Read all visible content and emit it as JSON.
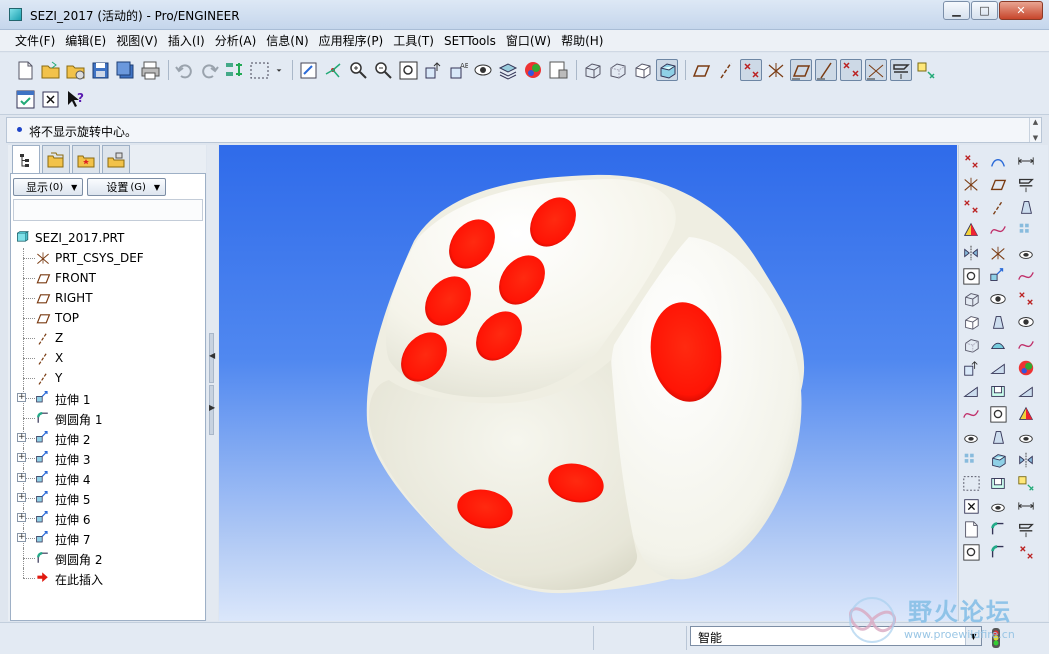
{
  "window": {
    "title": "SEZI_2017 (活动的) - Pro/ENGINEER",
    "minimize": "▁",
    "maximize": "□",
    "close": "✕"
  },
  "menu": [
    {
      "label": "文件(F)"
    },
    {
      "label": "编辑(E)"
    },
    {
      "label": "视图(V)"
    },
    {
      "label": "插入(I)"
    },
    {
      "label": "分析(A)"
    },
    {
      "label": "信息(N)"
    },
    {
      "label": "应用程序(P)"
    },
    {
      "label": "工具(T)"
    },
    {
      "label": "SETTools"
    },
    {
      "label": "窗口(W)"
    },
    {
      "label": "帮助(H)"
    }
  ],
  "toolbar": {
    "row1": [
      "new-icon",
      "open-icon",
      "open-folder-icon",
      "save-icon",
      "save-copy-icon",
      "print-icon",
      "|",
      "undo-icon",
      "redo-icon",
      "regenerate-icon",
      "select-box-icon",
      "dropdown-icon",
      "|",
      "repaint-icon",
      "spin-center-icon",
      "zoom-in-icon",
      "zoom-out-icon",
      "refit-icon",
      "orient-icon",
      "saved-views-icon",
      "appearance-icon",
      "layers-icon",
      "color-icon",
      "model-tree-icon",
      "|",
      "wireframe-icon",
      "hidden-line-icon",
      "no-hidden-icon",
      "shading-icon",
      "|",
      "datum-plane-icon",
      "datum-axis-icon",
      "datum-point-icon",
      "csys-icon",
      "plane-tag-icon",
      "axis-tag-icon",
      "point-tag-icon",
      "csys-tag-icon",
      "annotation-icon",
      "tool-icon"
    ],
    "row2": [
      "view-manager-icon",
      "close-window-icon",
      "context-help-icon"
    ],
    "pressed": [
      "shading-icon",
      "datum-point-icon",
      "plane-tag-icon",
      "axis-tag-icon",
      "point-tag-icon",
      "csys-tag-icon",
      "annotation-icon"
    ]
  },
  "message": {
    "text": "将不显示旋转中心。"
  },
  "navigator": {
    "show_button": "显示",
    "show_key": "(0)",
    "settings_button": "设置",
    "settings_key": "(G)"
  },
  "tree": [
    {
      "label": "SEZI_2017.PRT",
      "icon": "part-icon",
      "level": 0
    },
    {
      "label": "PRT_CSYS_DEF",
      "icon": "csys-icon",
      "level": 1
    },
    {
      "label": "FRONT",
      "icon": "datum-plane-icon",
      "level": 1
    },
    {
      "label": "RIGHT",
      "icon": "datum-plane-icon",
      "level": 1
    },
    {
      "label": "TOP",
      "icon": "datum-plane-icon",
      "level": 1
    },
    {
      "label": "Z",
      "icon": "datum-axis-icon",
      "level": 1
    },
    {
      "label": "X",
      "icon": "datum-axis-icon",
      "level": 1
    },
    {
      "label": "Y",
      "icon": "datum-axis-icon",
      "level": 1
    },
    {
      "label": "拉伸 1",
      "icon": "extrude-icon",
      "level": 1,
      "expandable": true
    },
    {
      "label": "倒圆角 1",
      "icon": "round-icon",
      "level": 1
    },
    {
      "label": "拉伸 2",
      "icon": "extrude-icon",
      "level": 1,
      "expandable": true
    },
    {
      "label": "拉伸 3",
      "icon": "extrude-icon",
      "level": 1,
      "expandable": true
    },
    {
      "label": "拉伸 4",
      "icon": "extrude-icon",
      "level": 1,
      "expandable": true
    },
    {
      "label": "拉伸 5",
      "icon": "extrude-icon",
      "level": 1,
      "expandable": true
    },
    {
      "label": "拉伸 6",
      "icon": "extrude-icon",
      "level": 1,
      "expandable": true
    },
    {
      "label": "拉伸 7",
      "icon": "extrude-icon",
      "level": 1,
      "expandable": true
    },
    {
      "label": "倒圆角 2",
      "icon": "round-icon",
      "level": 1
    },
    {
      "label": "在此插入",
      "icon": "insert-here-icon",
      "level": 1
    }
  ],
  "viewport": {
    "model": "dice",
    "top_pips": 6,
    "right_pips": 1,
    "front_pips": 2,
    "pip_color": "#ff1a0a",
    "body_color": "#f4f3ea"
  },
  "status": {
    "filter_value": "智能"
  },
  "watermark": {
    "title": "野火论坛",
    "url": "www.proewildfire.cn"
  }
}
